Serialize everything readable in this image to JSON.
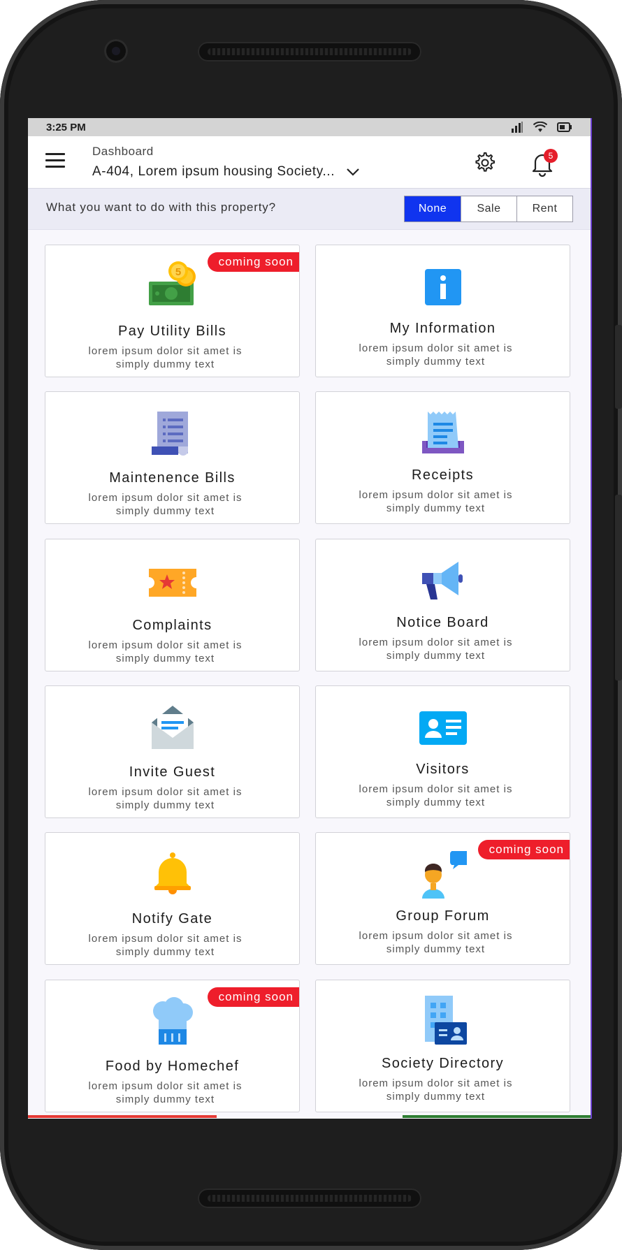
{
  "status_bar": {
    "time": "3:25 PM"
  },
  "app_bar": {
    "subtitle": "Dashboard",
    "title": "A-404, Lorem ipsum housing Society...",
    "notification_count": "5"
  },
  "property_bar": {
    "question": "What you want to do with this property?",
    "options": [
      "None",
      "Sale",
      "Rent"
    ],
    "selected": "None"
  },
  "services": [
    {
      "name": "Pay Utility Bills",
      "desc": "lorem ipsum dolor sit amet is simply dummy text",
      "badge": "coming soon",
      "icon": "money-coins-icon"
    },
    {
      "name": "My Information",
      "desc": "lorem ipsum dolor sit amet is simply dummy text",
      "badge": "",
      "icon": "info-icon"
    },
    {
      "name": "Maintenence Bills",
      "desc": "lorem ipsum dolor sit amet is simply dummy text",
      "badge": "",
      "icon": "document-list-icon"
    },
    {
      "name": "Receipts",
      "desc": "lorem ipsum dolor sit amet is simply dummy text",
      "badge": "",
      "icon": "receipt-icon"
    },
    {
      "name": "Complaints",
      "desc": "lorem ipsum dolor sit amet is simply dummy text",
      "badge": "",
      "icon": "ticket-star-icon"
    },
    {
      "name": "Notice Board",
      "desc": "lorem ipsum dolor sit amet is simply dummy text",
      "badge": "",
      "icon": "megaphone-icon"
    },
    {
      "name": "Invite Guest",
      "desc": "lorem ipsum dolor sit amet is simply dummy text",
      "badge": "",
      "icon": "envelope-icon"
    },
    {
      "name": "Visitors",
      "desc": "lorem ipsum dolor sit amet is simply dummy text",
      "badge": "",
      "icon": "id-card-icon"
    },
    {
      "name": "Notify Gate",
      "desc": "lorem ipsum dolor sit amet is simply dummy text",
      "badge": "",
      "icon": "bell-icon"
    },
    {
      "name": "Group Forum",
      "desc": "lorem ipsum dolor sit amet is simply dummy text",
      "badge": "coming soon",
      "icon": "person-chat-icon"
    },
    {
      "name": "Food by Homechef",
      "desc": "lorem ipsum dolor sit amet is simply dummy text",
      "badge": "coming soon",
      "icon": "chef-hat-icon"
    },
    {
      "name": "Society Directory",
      "desc": "lorem ipsum dolor sit amet is simply dummy text",
      "badge": "",
      "icon": "building-contact-icon"
    }
  ],
  "colors": {
    "accent": "#1034ef",
    "badge": "#ee1e2b",
    "background": "#f8f7fc"
  }
}
